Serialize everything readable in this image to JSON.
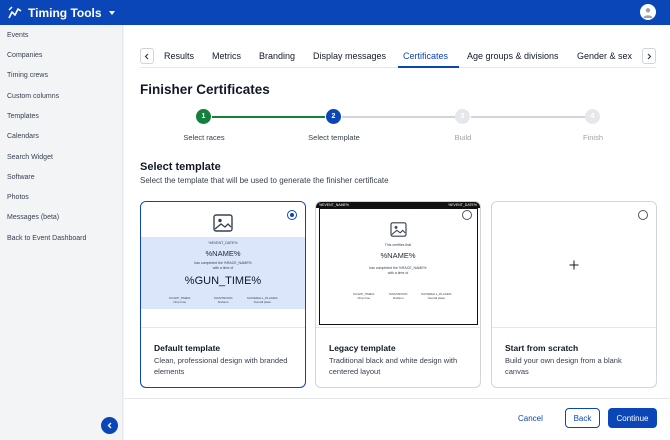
{
  "app": {
    "title": "Timing Tools"
  },
  "sidebar": {
    "items": [
      {
        "label": "Events"
      },
      {
        "label": "Companies"
      },
      {
        "label": "Timing crews"
      },
      {
        "label": "Custom columns"
      },
      {
        "label": "Templates"
      },
      {
        "label": "Calendars"
      },
      {
        "label": "Search Widget"
      },
      {
        "label": "Software"
      },
      {
        "label": "Photos"
      },
      {
        "label": "Messages (beta)"
      },
      {
        "label": "Back to Event Dashboard"
      }
    ]
  },
  "tabs": [
    {
      "label": "Results"
    },
    {
      "label": "Metrics"
    },
    {
      "label": "Branding"
    },
    {
      "label": "Display messages"
    },
    {
      "label": "Certificates"
    },
    {
      "label": "Age groups & divisions"
    },
    {
      "label": "Gender & sex"
    }
  ],
  "active_tab": "Certificates",
  "page": {
    "title": "Finisher Certificates"
  },
  "stepper": {
    "steps": [
      {
        "number": "1",
        "label": "Select races",
        "state": "complete"
      },
      {
        "number": "2",
        "label": "Select template",
        "state": "current"
      },
      {
        "number": "3",
        "label": "Build",
        "state": "upcoming"
      },
      {
        "number": "4",
        "label": "Finish",
        "state": "upcoming"
      }
    ]
  },
  "section": {
    "title": "Select template",
    "subtitle": "Select the template that will be used to generate the finisher certificate"
  },
  "templates": [
    {
      "title": "Default template",
      "description": "Clean, professional design with branded elements",
      "selected": true,
      "preview": {
        "event_date": "%EVENT_DATE%",
        "name": "%NAME%",
        "completed_line": "has completed the %RACE_NAME%",
        "time_line": "with a time of",
        "gun_time": "%GUN_TIME%",
        "columns": [
          {
            "value": "%CHIP_TIME%",
            "label": "Chip time"
          },
          {
            "value": "%DIVISION%",
            "label": "Division"
          },
          {
            "value": "%OVERALL_PLACE%",
            "label": "Overall place"
          }
        ]
      }
    },
    {
      "title": "Legacy template",
      "description": "Traditional black and white design with centered layout",
      "selected": false,
      "preview": {
        "header_left": "%EVENT_NAME%",
        "header_right": "%EVENT_DATE%",
        "certifies": "This certifies that",
        "name": "%NAME%",
        "completed_line": "has completed the %RACE_NAME%",
        "time_line": "with a time of",
        "columns": [
          {
            "value": "%CHIP_TIME%",
            "label": "Chip time"
          },
          {
            "value": "%DIVISION%",
            "label": "Division"
          },
          {
            "value": "%OVERALL_PLACE%",
            "label": "Overall place"
          }
        ]
      }
    },
    {
      "title": "Start from scratch",
      "description": "Build your own design from a blank canvas",
      "selected": false,
      "preview": {
        "icon": "plus-icon"
      }
    }
  ],
  "footer": {
    "cancel_label": "Cancel",
    "back_label": "Back",
    "continue_label": "Continue"
  },
  "colors": {
    "primary": "#0b46b8",
    "step_complete": "#15803d",
    "step_upcoming": "#d1d5db",
    "preview_band": "#dbe6fb"
  },
  "icons": [
    "chart-icon",
    "chevron-down-icon",
    "user-icon",
    "chevron-left-icon",
    "chevron-right-icon",
    "image-icon",
    "plus-icon"
  ]
}
